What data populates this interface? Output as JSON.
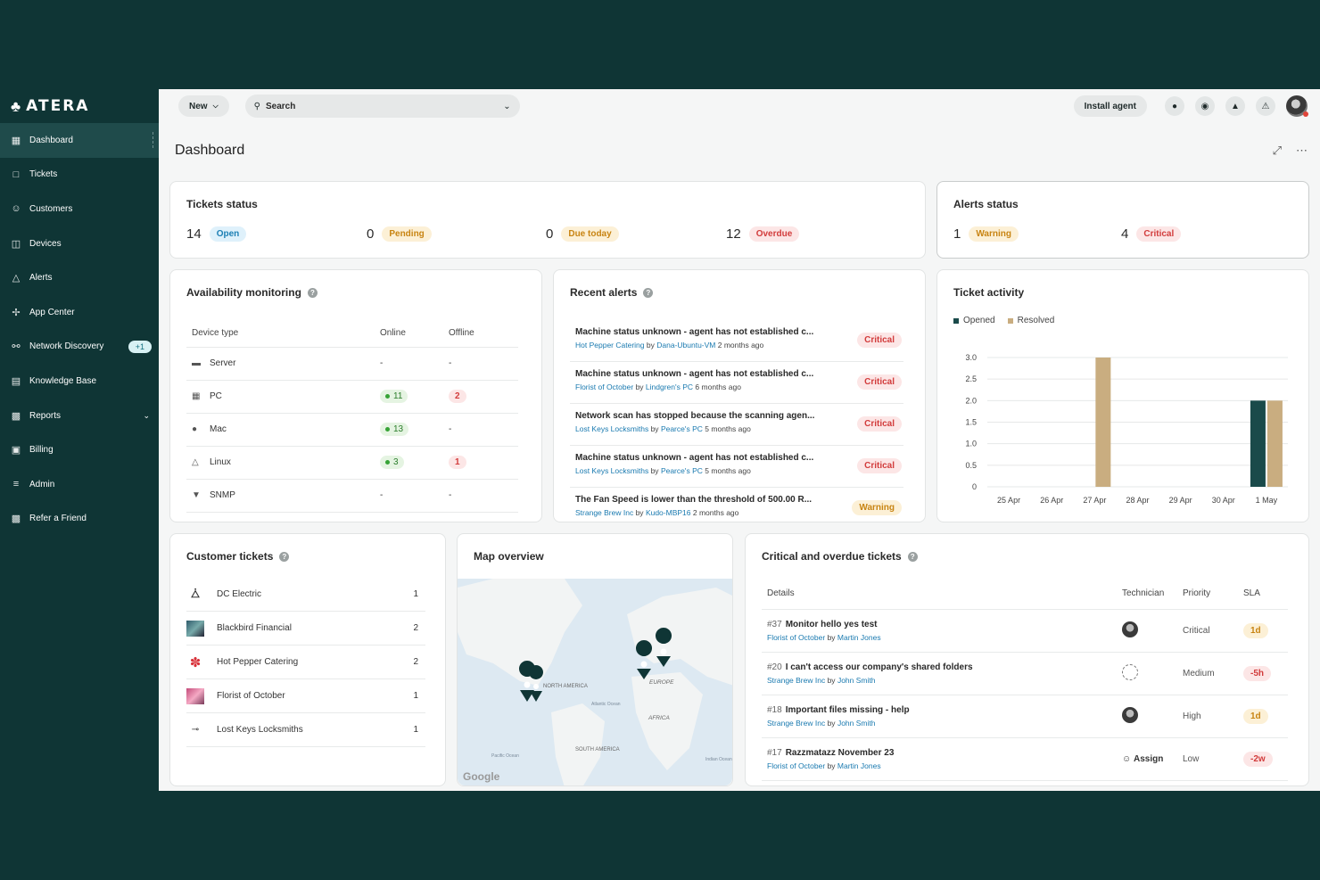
{
  "brand": {
    "name": "ATERA"
  },
  "sidebar": {
    "items": [
      {
        "label": "Dashboard",
        "icon": "grid-icon"
      },
      {
        "label": "Tickets",
        "icon": "ticket-icon"
      },
      {
        "label": "Customers",
        "icon": "users-icon"
      },
      {
        "label": "Devices",
        "icon": "monitor-icon"
      },
      {
        "label": "Alerts",
        "icon": "warning-icon"
      },
      {
        "label": "App Center",
        "icon": "puzzle-icon"
      },
      {
        "label": "Network Discovery",
        "icon": "network-icon",
        "badge": "+1"
      },
      {
        "label": "Knowledge Base",
        "icon": "book-icon"
      },
      {
        "label": "Reports",
        "icon": "bar-chart-icon"
      },
      {
        "label": "Billing",
        "icon": "wallet-icon"
      },
      {
        "label": "Admin",
        "icon": "sliders-icon"
      },
      {
        "label": "Refer a Friend",
        "icon": "gift-icon"
      }
    ]
  },
  "topbar": {
    "new_label": "New",
    "search_placeholder": "Search",
    "install_label": "Install agent"
  },
  "page": {
    "title": "Dashboard"
  },
  "tickets_status": {
    "title": "Tickets status",
    "items": [
      {
        "count": "14",
        "label": "Open"
      },
      {
        "count": "0",
        "label": "Pending"
      },
      {
        "count": "0",
        "label": "Due today"
      },
      {
        "count": "12",
        "label": "Overdue"
      }
    ]
  },
  "alerts_status": {
    "title": "Alerts status",
    "items": [
      {
        "count": "1",
        "label": "Warning"
      },
      {
        "count": "4",
        "label": "Critical"
      }
    ]
  },
  "availability": {
    "title": "Availability monitoring",
    "headers": [
      "Device type",
      "Online",
      "Offline"
    ],
    "rows": [
      {
        "type": "Server",
        "online": "-",
        "offline": "-"
      },
      {
        "type": "PC",
        "online": "11",
        "offline": "2"
      },
      {
        "type": "Mac",
        "online": "13",
        "offline": "-"
      },
      {
        "type": "Linux",
        "online": "3",
        "offline": "1"
      },
      {
        "type": "SNMP",
        "online": "-",
        "offline": "-"
      }
    ]
  },
  "recent_alerts": {
    "title": "Recent alerts",
    "items": [
      {
        "title": "Machine status unknown - agent has not established c...",
        "customer": "Hot Pepper Catering",
        "by": "by",
        "device": "Dana-Ubuntu-VM",
        "time": "2 months ago",
        "severity": "Critical"
      },
      {
        "title": "Machine status unknown - agent has not established c...",
        "customer": "Florist of October",
        "by": "by",
        "device": "Lindgren's PC",
        "time": "6 months ago",
        "severity": "Critical"
      },
      {
        "title": "Network scan has stopped because the scanning agen...",
        "customer": "Lost Keys Locksmiths",
        "by": "by",
        "device": "Pearce's PC",
        "time": "5 months ago",
        "severity": "Critical"
      },
      {
        "title": "Machine status unknown - agent has not established c...",
        "customer": "Lost Keys Locksmiths",
        "by": "by",
        "device": "Pearce's PC",
        "time": "5 months ago",
        "severity": "Critical"
      },
      {
        "title": "The Fan Speed is lower than the threshold of 500.00 R...",
        "customer": "Strange Brew Inc",
        "by": "by",
        "device": "Kudo-MBP16",
        "time": "2 months ago",
        "severity": "Warning"
      }
    ]
  },
  "ticket_activity": {
    "title": "Ticket activity",
    "colors": {
      "opened": "#1a4a4a",
      "resolved": "#c9ad80"
    }
  },
  "chart_data": {
    "type": "bar",
    "categories": [
      "25 Apr",
      "26 Apr",
      "27 Apr",
      "28 Apr",
      "29 Apr",
      "30 Apr",
      "1 May"
    ],
    "series": [
      {
        "name": "Opened",
        "values": [
          0,
          0,
          0,
          0,
          0,
          0,
          2
        ]
      },
      {
        "name": "Resolved",
        "values": [
          0,
          0,
          3,
          0,
          0,
          0,
          2
        ]
      }
    ],
    "ylim": [
      0,
      3
    ],
    "yticks": [
      "0",
      "0.5",
      "1.0",
      "1.5",
      "2.0",
      "2.5",
      "3.0"
    ],
    "legend": "top-left",
    "grid": true
  },
  "customer_tickets": {
    "title": "Customer tickets",
    "rows": [
      {
        "name": "DC Electric",
        "count": "1"
      },
      {
        "name": "Blackbird Financial",
        "count": "2"
      },
      {
        "name": "Hot Pepper Catering",
        "count": "2"
      },
      {
        "name": "Florist of October",
        "count": "1"
      },
      {
        "name": "Lost Keys Locksmiths",
        "count": "1"
      }
    ]
  },
  "map": {
    "title": "Map overview",
    "labels": [
      "NORTH AMERICA",
      "EUROPE",
      "AFRICA",
      "SOUTH AMERICA",
      "Atlantic Ocean",
      "Pacific Ocean",
      "Indian Ocean"
    ],
    "attribution": "Google"
  },
  "critical_tickets": {
    "title": "Critical and overdue tickets",
    "headers": [
      "Details",
      "Technician",
      "Priority",
      "SLA"
    ],
    "rows": [
      {
        "id": "#37",
        "title": "Monitor hello yes test",
        "customer": "Florist of October",
        "by": "by",
        "tech": "Martin Jones",
        "technician": "",
        "priority": "Critical",
        "sla": "1d",
        "sla_kind": "o"
      },
      {
        "id": "#20",
        "title": "I can't access our company's shared folders",
        "customer": "Strange Brew Inc",
        "by": "by",
        "tech": "John Smith",
        "technician": "",
        "priority": "Medium",
        "sla": "-5h",
        "sla_kind": "r"
      },
      {
        "id": "#18",
        "title": "Important files missing - help",
        "customer": "Strange Brew Inc",
        "by": "by",
        "tech": "John Smith",
        "technician": "",
        "priority": "High",
        "sla": "1d",
        "sla_kind": "o"
      },
      {
        "id": "#17",
        "title": "Razzmatazz November 23",
        "customer": "Florist of October",
        "by": "by",
        "tech": "Martin Jones",
        "technician": "Assign",
        "priority": "Low",
        "sla": "-2w",
        "sla_kind": "r"
      }
    ]
  }
}
